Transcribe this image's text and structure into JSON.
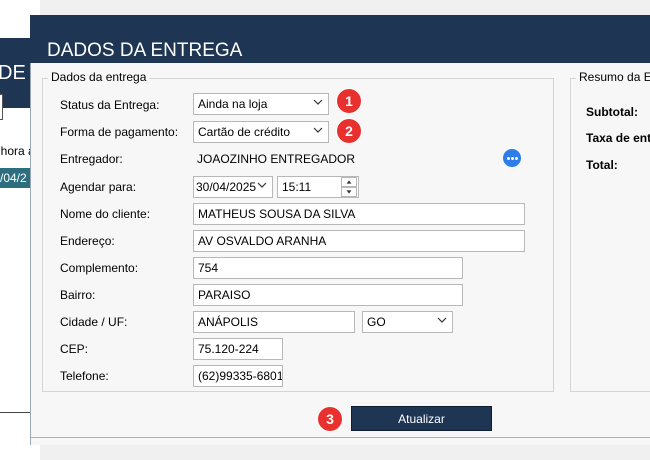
{
  "background_window": {
    "title_fragment": "DE E",
    "text_fragment": "nhora a",
    "selected_fragment": "/04/2"
  },
  "dialog": {
    "title": "DADOS DA ENTREGA",
    "colors": {
      "header": "#1e3553",
      "button": "#1e3553",
      "badge": "#e8302e",
      "accent_icon": "#2e7de9"
    }
  },
  "group_entrega": {
    "legend": "Dados da entrega",
    "fields": {
      "status": {
        "label": "Status da Entrega:",
        "value": "Ainda na loja"
      },
      "payment": {
        "label": "Forma de pagamento:",
        "value": "Cartão de crédito"
      },
      "courier": {
        "label": "Entregador:",
        "value": "JOAOZINHO ENTREGADOR"
      },
      "schedule": {
        "label": "Agendar para:",
        "date": "30/04/2025",
        "time": "15:11"
      },
      "customer": {
        "label": "Nome do cliente:",
        "value": "MATHEUS SOUSA DA SILVA"
      },
      "address": {
        "label": "Endereço:",
        "value": "AV OSVALDO ARANHA"
      },
      "complement": {
        "label": "Complemento:",
        "value": "754"
      },
      "district": {
        "label": "Bairro:",
        "value": "PARAISO"
      },
      "city": {
        "label": "Cidade / UF:",
        "value": "ANÁPOLIS",
        "uf": "GO"
      },
      "cep": {
        "label": "CEP:",
        "value": "75.120-224"
      },
      "phone": {
        "label": "Telefone:",
        "value": "(62)99335-6801"
      }
    }
  },
  "group_resumo": {
    "legend": "Resumo da En",
    "subtotal_label": "Subtotal:",
    "fee_label": "Taxa de entr",
    "total_label": "Total:"
  },
  "badges": {
    "one": "1",
    "two": "2",
    "three": "3"
  },
  "update_button": {
    "label": "Atualizar"
  }
}
